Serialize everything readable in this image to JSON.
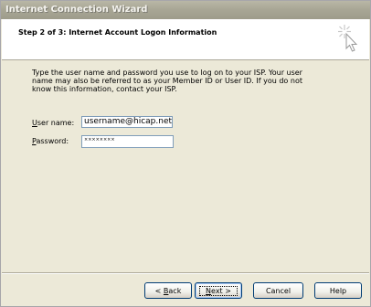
{
  "window": {
    "title": "Internet Connection Wizard"
  },
  "header": {
    "title": "Step 2 of 3: Internet Account Logon Information",
    "icon": "wizard-cursor-sparkle-icon"
  },
  "body": {
    "instructions": "Type the user name and password you use to log on to your ISP. Your user name may also be referred to as your Member ID or User ID. If you do not know this information, contact your ISP."
  },
  "form": {
    "username": {
      "label_mnemonic": "U",
      "label_rest": "ser name:",
      "value": "username@hicap.net"
    },
    "password": {
      "label_mnemonic": "P",
      "label_rest": "assword:",
      "value": "××××××××"
    }
  },
  "buttons": {
    "back_prefix": "< ",
    "back_mnemonic": "B",
    "back_rest": "ack",
    "next_mnemonic": "N",
    "next_rest": "ext >",
    "cancel": "Cancel",
    "help": "Help"
  }
}
